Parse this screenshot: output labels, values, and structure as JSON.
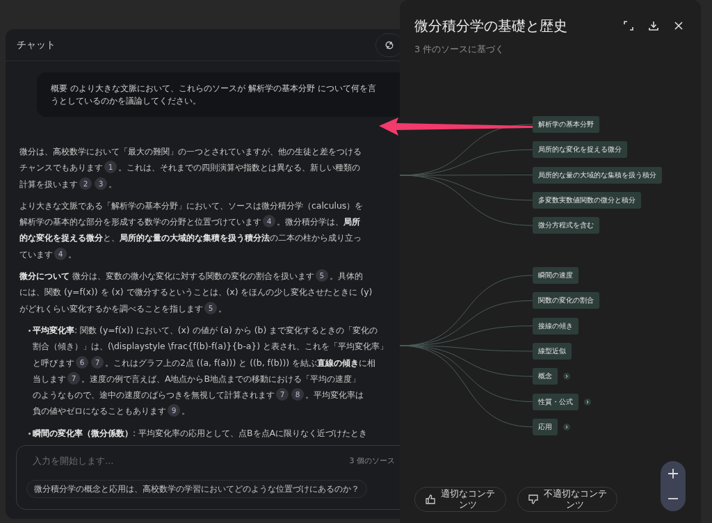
{
  "chat": {
    "title": "チャット",
    "query_lines": [
      "概要 のより大きな文脈において、これらのソースが 解析学の基本分野 について何を言",
      "うとしているのかを議論してください。"
    ],
    "blocks": [
      {
        "kind": "paragraph",
        "lines": [
          [
            {
              "kind": "text",
              "text": "微分は、高校数学において「最大の難関」の一つとされていますが、他の生徒と差をつける"
            }
          ],
          [
            {
              "kind": "text",
              "text": "チャンスでもあります"
            },
            {
              "kind": "cite",
              "text": "1"
            },
            {
              "kind": "text",
              "text": "。これは、それまでの四則演算や指数とは異なる、新しい種類の"
            }
          ],
          [
            {
              "kind": "text",
              "text": "計算を扱います"
            },
            {
              "kind": "cite",
              "text": "2"
            },
            {
              "kind": "cite",
              "text": "3"
            },
            {
              "kind": "text",
              "text": "。"
            }
          ]
        ]
      },
      {
        "kind": "paragraph",
        "lines": [
          [
            {
              "kind": "text",
              "text": "より大きな文脈である「解析学の基本分野」において、ソースは微分積分学（calculus）を"
            }
          ],
          [
            {
              "kind": "text",
              "text": "解析学の基本的な部分を形成する数学の分野と位置づけています"
            },
            {
              "kind": "cite",
              "text": "4"
            },
            {
              "kind": "text",
              "text": "。微分積分学は、**局所**"
            }
          ],
          [
            {
              "kind": "text",
              "text": "**的な変化を捉える微分**と、**局所的な量の大域的な集積を扱う積分法**の二本の柱から成り立っ"
            }
          ],
          [
            {
              "kind": "text",
              "text": "ています"
            },
            {
              "kind": "cite",
              "text": "4"
            },
            {
              "kind": "text",
              "text": "。"
            }
          ]
        ]
      },
      {
        "kind": "paragraph",
        "lines": [
          [
            {
              "kind": "text",
              "text": "**微分について** 微分は、変数の微小な変化に対する関数の変化の割合を扱います"
            },
            {
              "kind": "cite",
              "text": "5"
            },
            {
              "kind": "text",
              "text": "。具体的"
            }
          ],
          [
            {
              "kind": "text",
              "text": "には、関数 (y=f(x)) を (x) で微分するということは、(x) をほんの少し変化させたときに (y)"
            }
          ],
          [
            {
              "kind": "text",
              "text": "がどれくらい変化するかを調べることを指します"
            },
            {
              "kind": "cite",
              "text": "5"
            },
            {
              "kind": "text",
              "text": "。"
            }
          ]
        ]
      },
      {
        "kind": "bullet",
        "lines": [
          [
            {
              "kind": "text",
              "text": "**平均変化率**: 関数 (y=f(x)) において、(x) の値が (a) から (b) まで変化するときの「変化の"
            }
          ],
          [
            {
              "kind": "text",
              "text": "割合（傾き）」は、(\\displaystyle \\frac{f(b)-f(a)}{b-a}) と表され、これを「平均変化率」"
            }
          ],
          [
            {
              "kind": "text",
              "text": "と呼びます"
            },
            {
              "kind": "cite",
              "text": "6"
            },
            {
              "kind": "cite",
              "text": "7"
            },
            {
              "kind": "text",
              "text": "。これはグラフ上の2点 ((a, f(a))) と ((b, f(b))) を結ぶ**直線の傾き**に相"
            }
          ],
          [
            {
              "kind": "text",
              "text": "当します"
            },
            {
              "kind": "cite",
              "text": "7"
            },
            {
              "kind": "text",
              "text": "。速度の例で言えば、A地点からB地点までの移動における「平均の速度」"
            }
          ],
          [
            {
              "kind": "text",
              "text": "のようなもので、途中の速度のばらつきを無視して計算されます"
            },
            {
              "kind": "cite",
              "text": "7"
            },
            {
              "kind": "cite",
              "text": "8"
            },
            {
              "kind": "text",
              "text": "。平均変化率は"
            }
          ],
          [
            {
              "kind": "text",
              "text": "負の値やゼロになることもあります"
            },
            {
              "kind": "cite",
              "text": "9"
            },
            {
              "kind": "text",
              "text": "。"
            }
          ]
        ]
      },
      {
        "kind": "bullet",
        "lines": [
          [
            {
              "kind": "text",
              "text": "**瞬間の変化率（微分係数）**: 平均変化率の応用として、点Bを点Aに限りなく近づけたとき"
            }
          ]
        ]
      }
    ]
  },
  "input": {
    "placeholder": "入力を開始します...",
    "source_count": "3 個のソース",
    "suggestion": "微分積分学の概念と応用は、高校数学の学習においてどのような位置づけにあるのか？"
  },
  "mindmap": {
    "title": "微分積分学の基礎と歴史",
    "subtitle": "3 件のソースに基づく",
    "branches": [
      {
        "children": [
          {
            "label": "解析学の基本分野",
            "collapsed": false
          },
          {
            "label": "局所的な変化を捉える微分",
            "collapsed": false
          },
          {
            "label": "局所的な量の大域的な集積を扱う積分",
            "collapsed": false
          },
          {
            "label": "多変数実数値関数の微分と積分",
            "collapsed": false
          },
          {
            "label": "微分方程式を含む",
            "collapsed": false
          }
        ]
      },
      {
        "children": [
          {
            "label": "瞬間の速度",
            "collapsed": false
          },
          {
            "label": "関数の変化の割合",
            "collapsed": false
          },
          {
            "label": "接線の傾き",
            "collapsed": false
          },
          {
            "label": "線型近似",
            "collapsed": false
          },
          {
            "label": "概念",
            "collapsed": true
          },
          {
            "label": "性質・公式",
            "collapsed": true
          },
          {
            "label": "応用",
            "collapsed": true
          }
        ]
      }
    ],
    "feedback": [
      {
        "kind": "good",
        "label": "適切なコンテンツ"
      },
      {
        "kind": "bad",
        "label": "不適切なコンテンツ"
      }
    ]
  }
}
